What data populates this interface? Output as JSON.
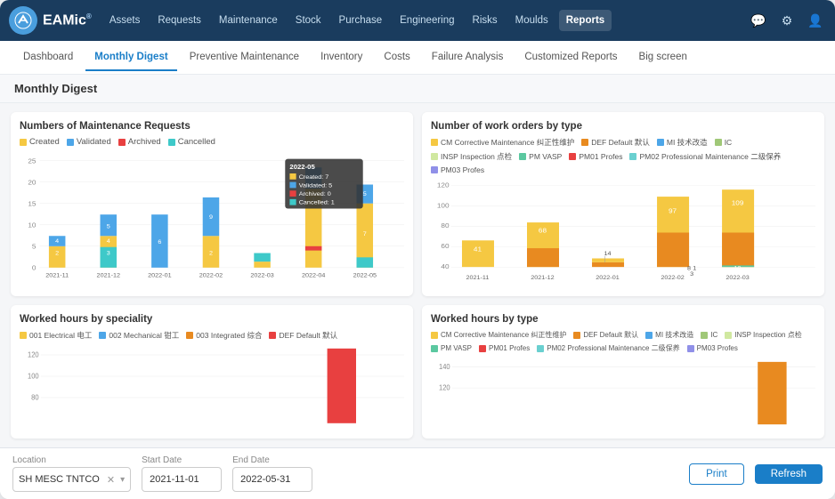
{
  "app": {
    "logo": "EAMic",
    "logo_sup": "®"
  },
  "top_nav": {
    "items": [
      {
        "label": "Assets",
        "active": false
      },
      {
        "label": "Requests",
        "active": false
      },
      {
        "label": "Maintenance",
        "active": false
      },
      {
        "label": "Stock",
        "active": false
      },
      {
        "label": "Purchase",
        "active": false
      },
      {
        "label": "Engineering",
        "active": false
      },
      {
        "label": "Risks",
        "active": false
      },
      {
        "label": "Moulds",
        "active": false
      },
      {
        "label": "Reports",
        "active": true
      }
    ]
  },
  "sub_nav": {
    "items": [
      {
        "label": "Dashboard",
        "active": false
      },
      {
        "label": "Monthly Digest",
        "active": true
      },
      {
        "label": "Preventive Maintenance",
        "active": false
      },
      {
        "label": "Inventory",
        "active": false
      },
      {
        "label": "Costs",
        "active": false
      },
      {
        "label": "Failure Analysis",
        "active": false
      },
      {
        "label": "Customized Reports",
        "active": false
      },
      {
        "label": "Big screen",
        "active": false
      }
    ]
  },
  "page_title": "Monthly Digest",
  "chart1": {
    "title": "Numbers of Maintenance Requests",
    "legend": [
      {
        "label": "Created",
        "color": "#f5c842"
      },
      {
        "label": "Validated",
        "color": "#4da6e8"
      },
      {
        "label": "Archived",
        "color": "#e84040"
      },
      {
        "label": "Cancelled",
        "color": "#3ec9c9"
      }
    ],
    "months": [
      "2021-11",
      "2021-12",
      "2022-01",
      "2022-02",
      "2022-03",
      "2022-04",
      "2022-05"
    ],
    "tooltip": {
      "month": "2022-05",
      "created": 7,
      "validated": 5,
      "archived": 0,
      "cancelled": 1
    }
  },
  "chart2": {
    "title": "Number of work orders by type",
    "legend": [
      {
        "label": "CM Corrective Maintenance 纠正性维护",
        "color": "#f5c842"
      },
      {
        "label": "DEF Default 默认",
        "color": "#e88a20"
      },
      {
        "label": "MI 技术改造",
        "color": "#4da6e8"
      },
      {
        "label": "IC",
        "color": "#a0c878"
      },
      {
        "label": "INSP Inspection 点检",
        "color": "#d0e8a0"
      },
      {
        "label": "PM VASP",
        "color": "#5bc8a0"
      },
      {
        "label": "PM01 Profes",
        "color": "#e84040"
      },
      {
        "label": "PM02 Professional Maintenance 二级保养",
        "color": "#6ad0d0"
      },
      {
        "label": "PM03 Profes",
        "color": "#9090e8"
      }
    ],
    "months": [
      "2021-11",
      "2021-12",
      "2022-01",
      "2022-02",
      "2022-03"
    ],
    "values": [
      41,
      68,
      14,
      97,
      109
    ]
  },
  "chart3": {
    "title": "Worked hours by speciality",
    "legend": [
      {
        "label": "001 Electrical 电工",
        "color": "#f5c842"
      },
      {
        "label": "002 Mechanical 钳工",
        "color": "#4da6e8"
      },
      {
        "label": "003 Integrated 综合",
        "color": "#e88a20"
      },
      {
        "label": "DEF Default 默认",
        "color": "#e84040"
      }
    ]
  },
  "chart4": {
    "title": "Worked hours by type",
    "legend": [
      {
        "label": "CM Corrective Maintenance 纠正性维护",
        "color": "#f5c842"
      },
      {
        "label": "DEF Default 默认",
        "color": "#e88a20"
      },
      {
        "label": "MI 技术改造",
        "color": "#4da6e8"
      },
      {
        "label": "IC",
        "color": "#a0c878"
      },
      {
        "label": "INSP Inspection 点检",
        "color": "#d0e8a0"
      },
      {
        "label": "PM VASP",
        "color": "#5bc8a0"
      },
      {
        "label": "PM01 Profes",
        "color": "#e84040"
      },
      {
        "label": "PM02 Professional Maintenance 二级保养",
        "color": "#6ad0d0"
      },
      {
        "label": "PM03 Profes",
        "color": "#9090e8"
      }
    ]
  },
  "footer": {
    "location_label": "Location",
    "location_value": "SH MESC TNTCO",
    "start_date_label": "Start Date",
    "start_date_value": "2021-11-01",
    "end_date_label": "End Date",
    "end_date_value": "2022-05-31",
    "print_label": "Print",
    "refresh_label": "Refresh"
  }
}
